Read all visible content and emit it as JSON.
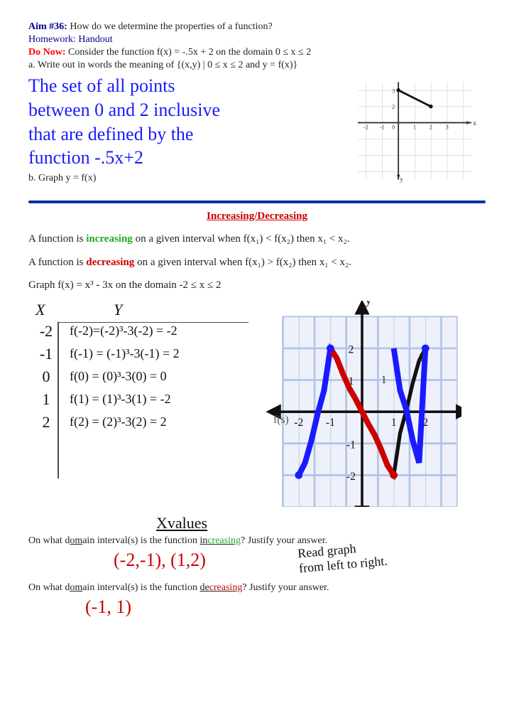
{
  "header": {
    "aim_label": "Aim #36:",
    "aim_text": " How do we determine the properties of a function?",
    "homework_text": "Homework: Handout",
    "do_now_label": "Do Now:",
    "do_now_text": " Consider the function f(x) = -.5x + 2 on the domain 0 ≤ x ≤ 2",
    "write_line": "a. Write out in words the meaning of {(x,y) | 0 ≤ x ≤ 2 and y = f(x)}"
  },
  "handwriting": {
    "line1": "The set of all points",
    "line2": "between 0 and 2 inclusive",
    "line3": "that are defined by the",
    "line4": "        function -.5x+2"
  },
  "graph_b_label": "b. Graph y = f(x)",
  "divider": true,
  "section": {
    "title": "Increasing/Decreasing",
    "def_increasing": "A function is increasing on a given interval when f(x₁) < f(x₂)  then x₁ < x₂.",
    "def_decreasing": "A function is decreasing on a given interval when f(x₁) > f(x₂)  then x₁ < x₂.",
    "graph_label": "Graph f(x) = x³ - 3x on the domain -2 ≤ x ≤ 2"
  },
  "table": {
    "header_x": "X",
    "header_y": "Y",
    "rows": [
      {
        "x": "-2",
        "expr": "f(-2)=(-2)³-3(-2) = -2"
      },
      {
        "x": "-1",
        "expr": "f(-1) = (-1)³-3(-1) = 2"
      },
      {
        "x": "0",
        "expr": "f(0) = (0)³-3(0) = 0"
      },
      {
        "x": "1",
        "expr": "f(1) = (1)³-3(1) = -2"
      },
      {
        "x": "2",
        "expr": "f(2) = (2)³-3(2) = 2"
      }
    ]
  },
  "questions": {
    "xvalues_label": "Xvalues",
    "q1": "On what domain interval(s) is the function increasing? Justify your answer.",
    "q1_answer": "(-2,-1), (1,2)",
    "q1_annotation": "Read graph",
    "q1_annotation2": "from left to right.",
    "q2": "On what domain interval(s) is the function decreasing? Justify your answer.",
    "q2_answer": "(-1, 1)"
  }
}
